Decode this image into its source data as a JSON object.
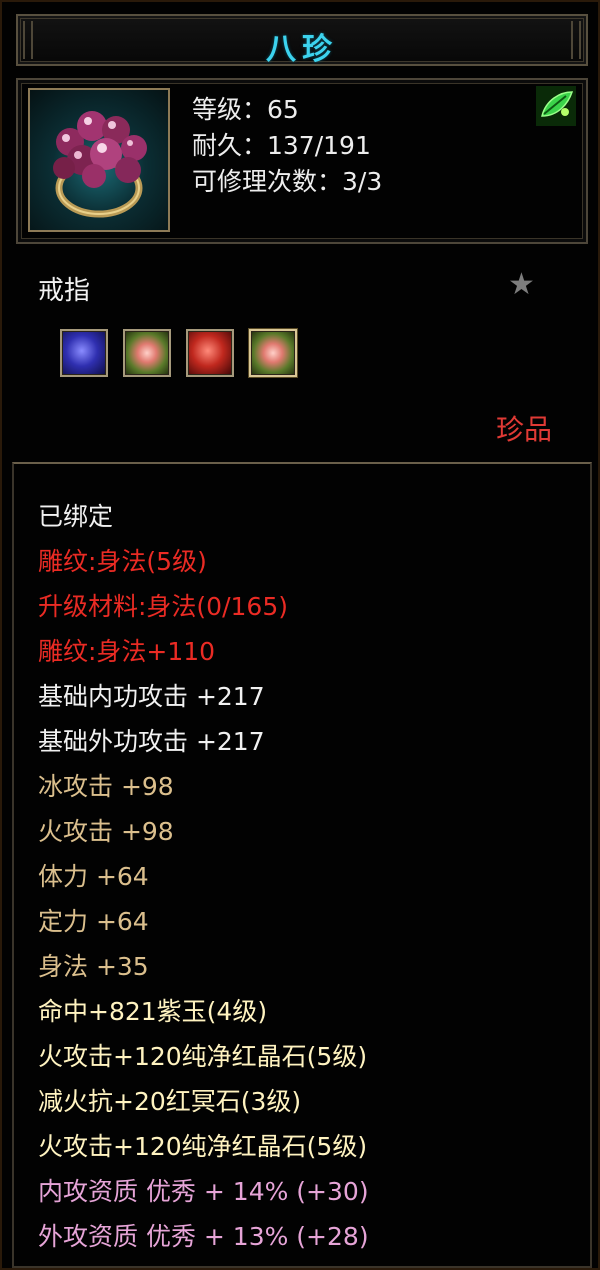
{
  "item": {
    "name": "八珍",
    "stats": {
      "level": "等级：65",
      "durability": "耐久：137/191",
      "repair": "可修理次数：3/3"
    },
    "type": "戒指",
    "rarity": "珍品",
    "icons": {
      "item": "ring-icon",
      "badge": "green-leaf-icon",
      "favorite": "star-icon"
    },
    "gems": [
      {
        "name": "blue-gem-icon"
      },
      {
        "name": "red-crystal-icon"
      },
      {
        "name": "red-gem-icon"
      },
      {
        "name": "red-crystal-icon"
      }
    ]
  },
  "attributes": [
    {
      "text": "已绑定",
      "color": "white"
    },
    {
      "text": "雕纹:身法(5级)",
      "color": "red"
    },
    {
      "text": "升级材料:身法(0/165)",
      "color": "red"
    },
    {
      "text": "雕纹:身法+110",
      "color": "red"
    },
    {
      "text": "基础内功攻击 +217",
      "color": "white"
    },
    {
      "text": "基础外功攻击 +217",
      "color": "white"
    },
    {
      "text": "冰攻击 +98",
      "color": "gold"
    },
    {
      "text": "火攻击 +98",
      "color": "gold"
    },
    {
      "text": "体力 +64",
      "color": "gold"
    },
    {
      "text": "定力 +64",
      "color": "gold"
    },
    {
      "text": "身法 +35",
      "color": "gold"
    },
    {
      "text": "命中+821紫玉(4级)",
      "color": "yellow"
    },
    {
      "text": "火攻击+120纯净红晶石(5级)",
      "color": "yellow"
    },
    {
      "text": "减火抗+20红冥石(3级)",
      "color": "yellow"
    },
    {
      "text": "火攻击+120纯净红晶石(5级)",
      "color": "yellow"
    },
    {
      "text": "内攻资质 优秀 + 14% (+30)",
      "color": "pink"
    },
    {
      "text": "外攻资质 优秀 + 13% (+28)",
      "color": "pink"
    }
  ],
  "colors": {
    "title": "#3cd3ee",
    "red": "#ea2b24",
    "gold": "#dbbf8d",
    "yellow": "#fff3c0",
    "pink": "#e6a4d7",
    "white": "#f1f1f1"
  }
}
